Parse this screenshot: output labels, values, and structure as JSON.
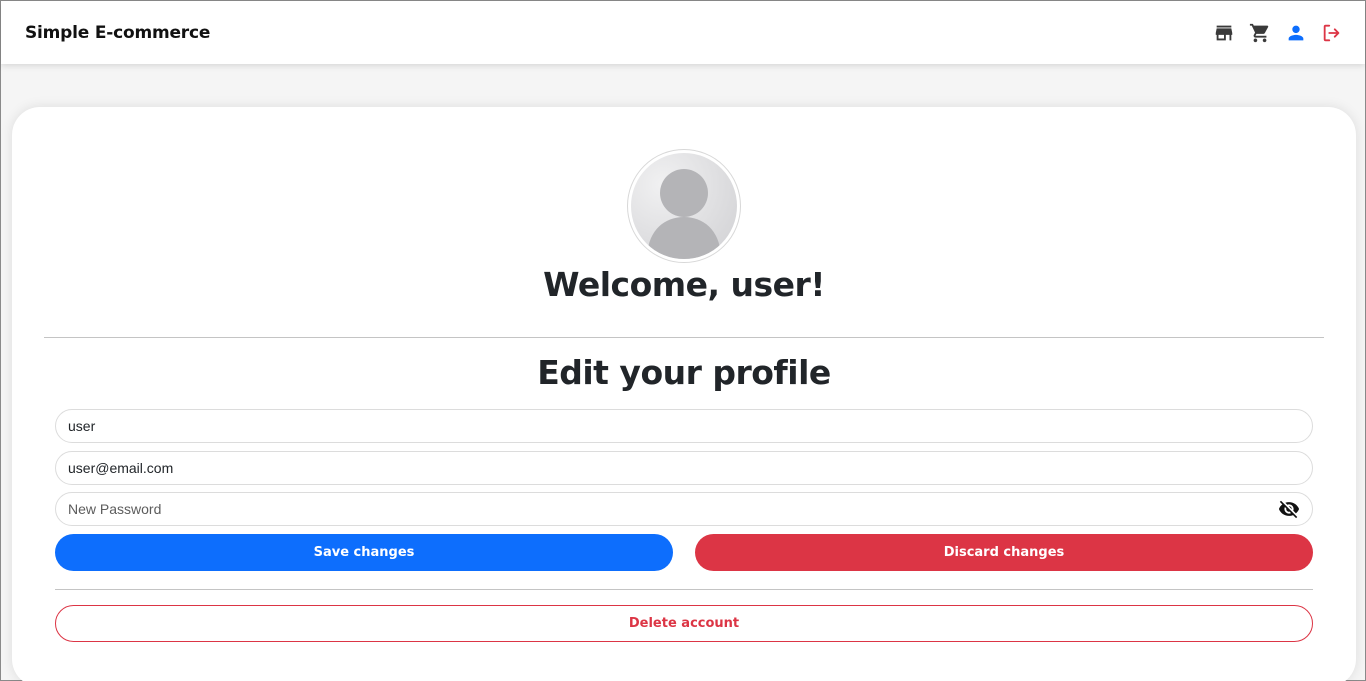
{
  "navbar": {
    "brand": "Simple E-commerce",
    "icons": [
      "store-icon",
      "cart-icon",
      "user-icon",
      "logout-icon"
    ]
  },
  "profile": {
    "welcome": "Welcome, user!",
    "edit_title": "Edit your profile",
    "username_value": "user",
    "email_value": "user@email.com",
    "password_placeholder": "New Password",
    "save_label": "Save changes",
    "discard_label": "Discard changes",
    "delete_label": "Delete account"
  },
  "colors": {
    "primary": "#0d6efd",
    "danger": "#dc3545",
    "user_icon": "#0d6efd",
    "logout_icon": "#dc3545"
  }
}
